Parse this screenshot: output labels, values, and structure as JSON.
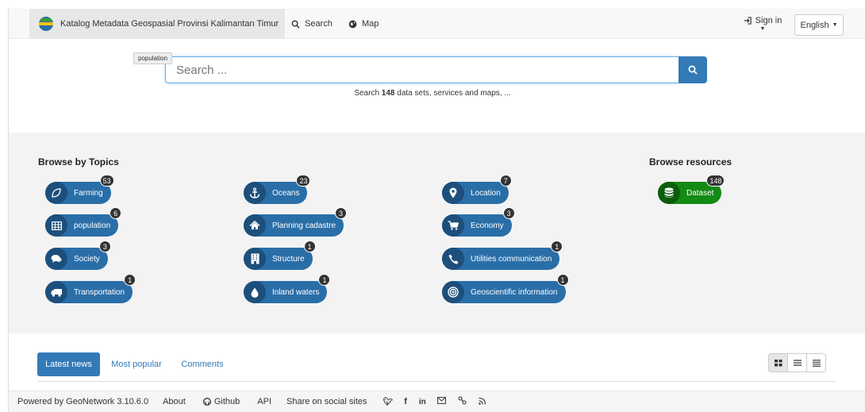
{
  "navbar": {
    "brand_title": "Katalog Metadata Geospasial Provinsi Kalimantan Timur",
    "links": [
      {
        "label": "Search",
        "icon": "search-icon"
      },
      {
        "label": "Map",
        "icon": "globe-icon"
      }
    ],
    "sign_in": "Sign in",
    "language": "English"
  },
  "search": {
    "placeholder": "Search ...",
    "tooltip": "population",
    "hint_prefix": "Search ",
    "hint_count": "148",
    "hint_suffix": " data sets, services and maps, ..."
  },
  "browse_topics": {
    "title": "Browse by Topics",
    "items": [
      {
        "label": "Farming",
        "count": "53",
        "icon": "leaf-icon"
      },
      {
        "label": "population",
        "count": "6",
        "icon": "table-icon"
      },
      {
        "label": "Society",
        "count": "3",
        "icon": "comments-icon"
      },
      {
        "label": "Transportation",
        "count": "1",
        "icon": "truck-icon"
      },
      {
        "label": "Oceans",
        "count": "23",
        "icon": "anchor-icon"
      },
      {
        "label": "Planning cadastre",
        "count": "3",
        "icon": "home-icon"
      },
      {
        "label": "Structure",
        "count": "1",
        "icon": "building-icon"
      },
      {
        "label": "Inland waters",
        "count": "1",
        "icon": "drop-icon"
      },
      {
        "label": "Location",
        "count": "7",
        "icon": "map-marker-icon"
      },
      {
        "label": "Economy",
        "count": "3",
        "icon": "cart-icon"
      },
      {
        "label": "Utilities communication",
        "count": "1",
        "icon": "phone-icon"
      },
      {
        "label": "Geoscientific information",
        "count": "1",
        "icon": "bullseye-icon"
      }
    ]
  },
  "browse_resources": {
    "title": "Browse resources",
    "items": [
      {
        "label": "Dataset",
        "count": "148",
        "icon": "database-icon",
        "color": "#138a13"
      }
    ]
  },
  "tabs": {
    "items": [
      "Latest news",
      "Most popular",
      "Comments"
    ],
    "active": "Latest news"
  },
  "view_modes": [
    "grid-view-icon",
    "list-view-icon",
    "compact-list-icon"
  ],
  "footer": {
    "powered_by": "Powered by GeoNetwork 3.10.6.0",
    "about": "About",
    "github": "Github",
    "api": "API",
    "share": "Share on social sites"
  },
  "colors": {
    "primary": "#2a6ea8",
    "primary_dark": "#1d4f7c",
    "link": "#337ab7",
    "dataset": "#138a13"
  }
}
